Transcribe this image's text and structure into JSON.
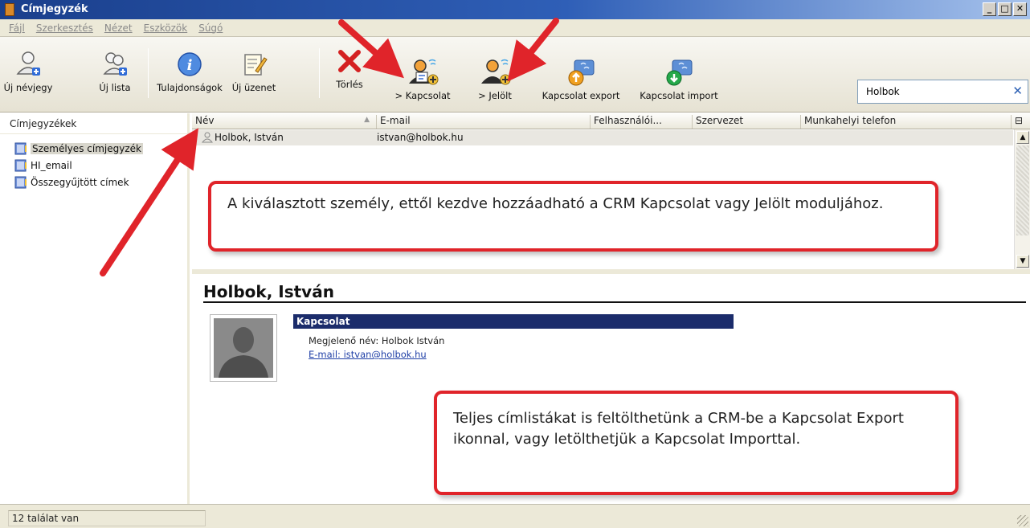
{
  "window": {
    "title": "Címjegyzék",
    "controls": [
      "_",
      "□",
      "✕"
    ]
  },
  "menubar": {
    "items": [
      "Fájl",
      "Szerkesztés",
      "Nézet",
      "Eszközök",
      "Súgó"
    ]
  },
  "toolbar": {
    "new_contact": "Új névjegy",
    "new_list": "Új lista",
    "properties": "Tulajdonságok",
    "new_message": "Új üzenet",
    "delete": "Törlés",
    "to_contact": "> Kapcsolat",
    "to_lead": "> Jelölt",
    "contact_export": "Kapcsolat export",
    "contact_import": "Kapcsolat import",
    "search_value": "Holbok"
  },
  "addressbooks": {
    "header": "Címjegyzékek",
    "items": [
      "Személyes címjegyzék",
      "HI_email",
      "Összegyűjtött címek"
    ]
  },
  "contact_list": {
    "columns": [
      "Név",
      "E-mail",
      "Felhasználói...",
      "Szervezet",
      "Munkahelyi telefon"
    ],
    "rows": [
      {
        "name": "Holbok, István",
        "email": "istvan@holbok.hu"
      }
    ]
  },
  "detail": {
    "name": "Holbok, István",
    "section_title": "Kapcsolat",
    "display_name": "Megjelenő név: Holbok István",
    "email_line": "E-mail: istvan@holbok.hu"
  },
  "status": {
    "text": "12 találat van"
  },
  "callouts": {
    "top": "A kiválasztott személy, ettől kezdve hozzáadható a CRM Kapcsolat vagy Jelölt moduljához.",
    "bottom": "Teljes címlistákat is feltölthetünk a CRM-be a Kapcsolat Export ikonnal, vagy letölthetjük a Kapcsolat Importtal."
  },
  "colors": {
    "title_bar": "#1a3f8c",
    "callout_border": "#e0242a",
    "section_header": "#1b2c6b"
  }
}
